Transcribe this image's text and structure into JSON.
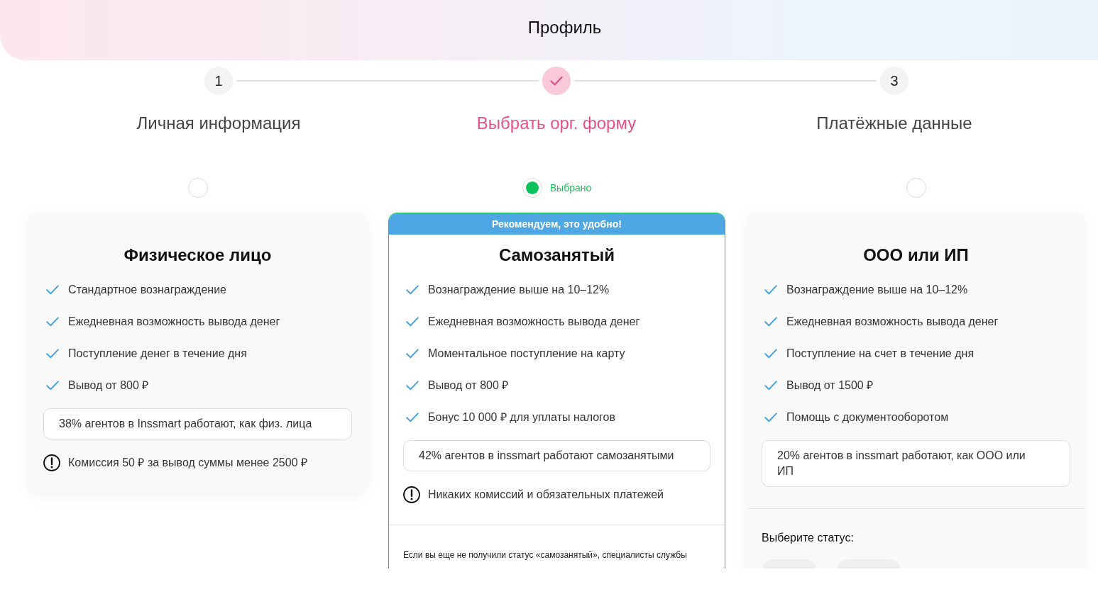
{
  "header": {
    "title": "Профиль"
  },
  "steps": [
    {
      "number": "1",
      "label": "Личная информация",
      "selected": false
    },
    {
      "label": "Выбрать орг. форму",
      "selected": true
    },
    {
      "number": "3",
      "label": "Платёжные данные",
      "selected": false
    }
  ],
  "options": [
    {
      "selected": false,
      "title": "Физическое лицо",
      "features": [
        "Стандартное вознаграждение",
        "Ежедневная возможность вывода денег",
        "Поступление денег в течение дня",
        "Вывод от 800 ₽"
      ],
      "note": "38% агентов в Inssmart работают, как физ. лица",
      "warning": "Комиссия 50 ₽ за вывод суммы менее 2500 ₽"
    },
    {
      "selected": true,
      "selected_label": "Выбрано",
      "badge": "Рекомендуем, это удобно!",
      "title": "Самозанятый",
      "features": [
        "Вознаграждение выше на 10–12%",
        "Ежедневная возможность вывода денег",
        "Моментальное поступление на карту",
        "Вывод от 800 ₽",
        "Бонус 10 000 ₽ для уплаты налогов"
      ],
      "note": "42% агентов в inssmart работают самозанятыми",
      "warning": "Никаких комиссий и обязательных платежей",
      "footer": {
        "kind": "text",
        "text": "Если вы еще не получили статус «самозанятый», специалисты службы"
      }
    },
    {
      "selected": false,
      "title": "ООО или ИП",
      "features": [
        "Вознаграждение выше на 10–12%",
        "Ежедневная возможность вывода денег",
        "Поступление на счет в течение дня",
        "Вывод от 1500 ₽",
        "Помощь с документооборотом"
      ],
      "note": "20% агентов в inssmart работают, как ООО или ИП",
      "footer": {
        "kind": "status_picker",
        "heading": "Выберите статус:",
        "options": [
          {
            "selected": false
          },
          {
            "selected": false
          }
        ]
      }
    }
  ]
}
